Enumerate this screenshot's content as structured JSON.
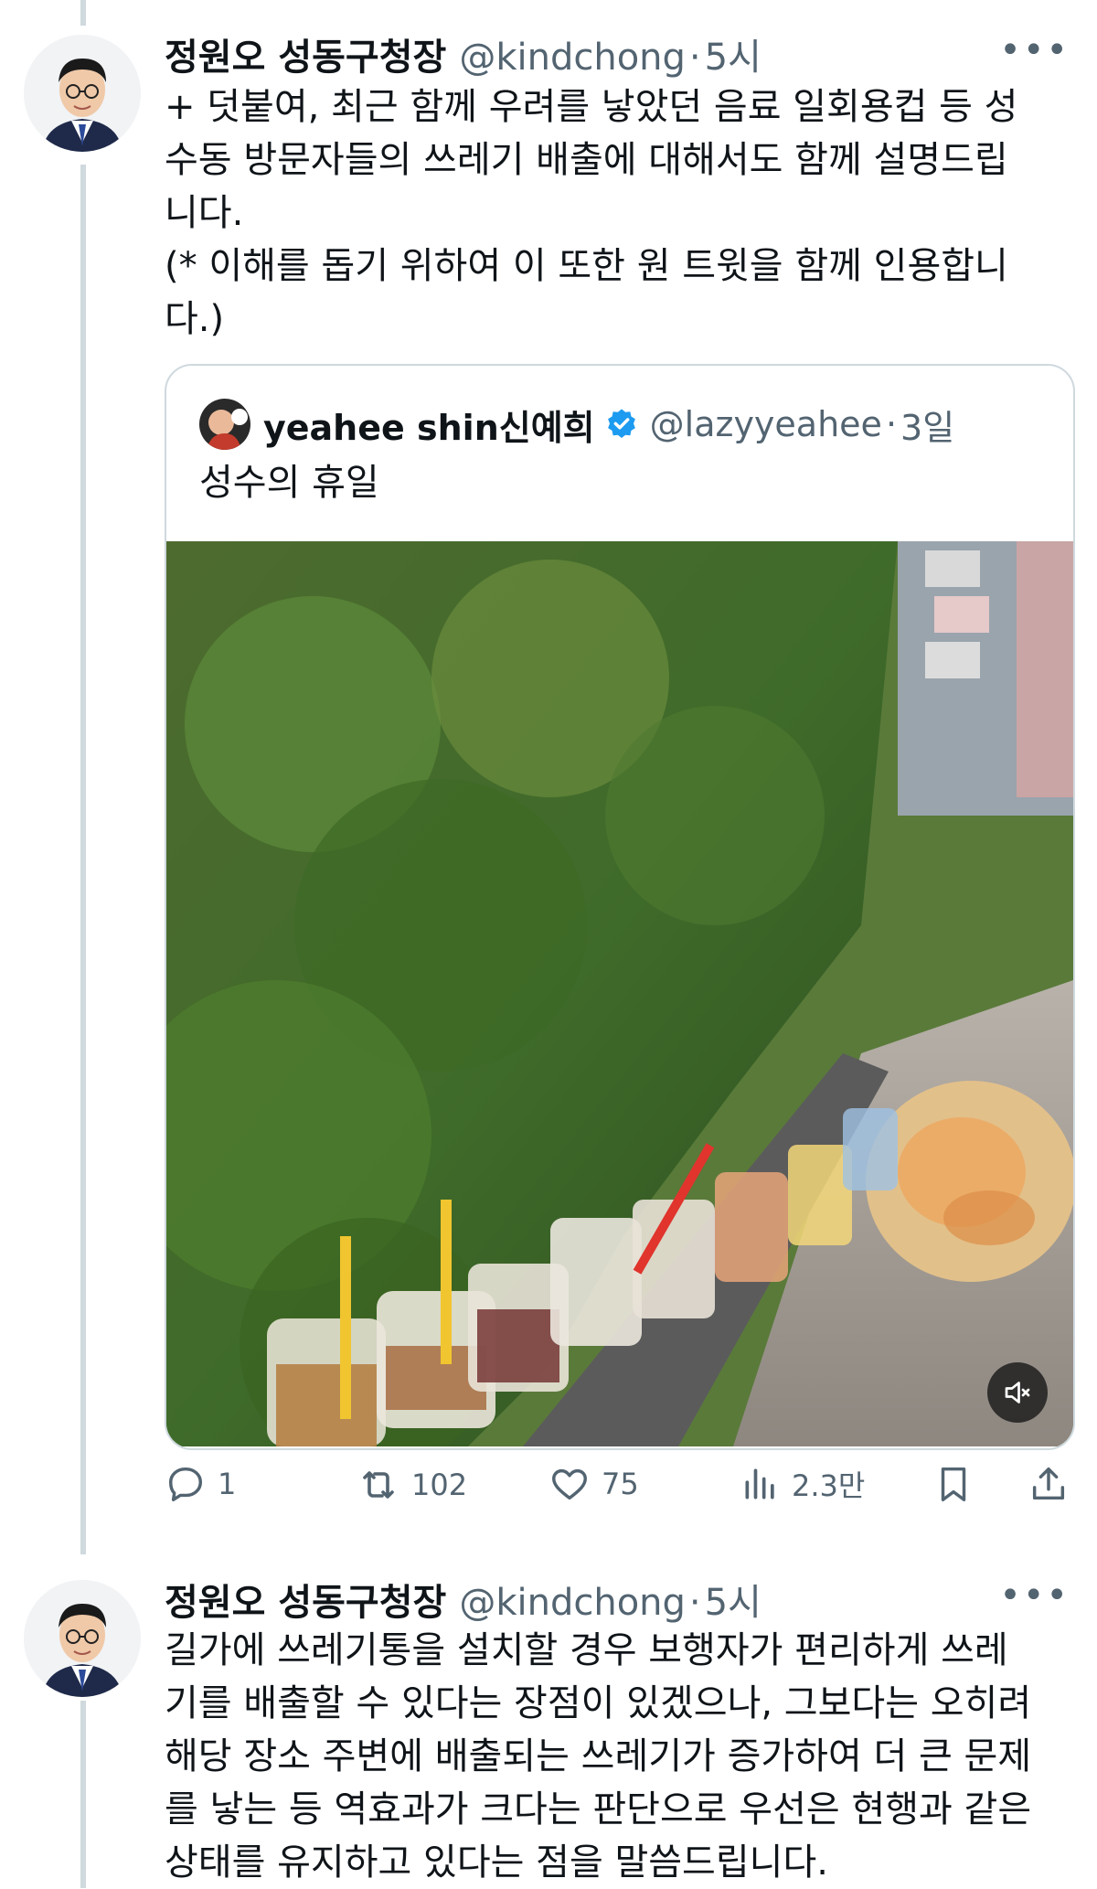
{
  "tweets": [
    {
      "author_name": "정원오 성동구청장",
      "handle": "@kindchong",
      "separator": "·",
      "time": "5시",
      "more_label": "•••",
      "text": "+ 덧붙여, 최근 함께 우려를 낳았던 음료 일회용컵 등 성\n수동 방문자들의 쓰레기 배출에 대해서도 함께 설명드립\n니다.\n(* 이해를 돕기 위하여 이 또한 원 트윗을 함께 인용합니\n다.)",
      "quote": {
        "author_name": "yeahee shin신예희",
        "verified": true,
        "handle": "@lazyyeahee",
        "separator": "·",
        "time": "3일",
        "text": "성수의 휴일",
        "media_icon": "mute-icon"
      },
      "actions": {
        "reply_count": "1",
        "retweet_count": "102",
        "like_count": "75",
        "view_count": "2.3만"
      }
    },
    {
      "author_name": "정원오 성동구청장",
      "handle": "@kindchong",
      "separator": "·",
      "time": "5시",
      "more_label": "•••",
      "text": "길가에 쓰레기통을 설치할 경우 보행자가 편리하게 쓰레\n기를 배출할 수 있다는 장점이 있겠으나, 그보다는 오히려\n해당 장소 주변에 배출되는 쓰레기가 증가하여 더 큰 문제\n를 낳는 등 역효과가 크다는 판단으로 우선은 현행과 같은\n상태를 유지하고 있다는 점을 말씀드립니다."
    }
  ],
  "colors": {
    "text_primary": "#0f1419",
    "text_secondary": "#536471",
    "verified_blue": "#1d9bf0",
    "thread_line": "#cfd9de"
  }
}
